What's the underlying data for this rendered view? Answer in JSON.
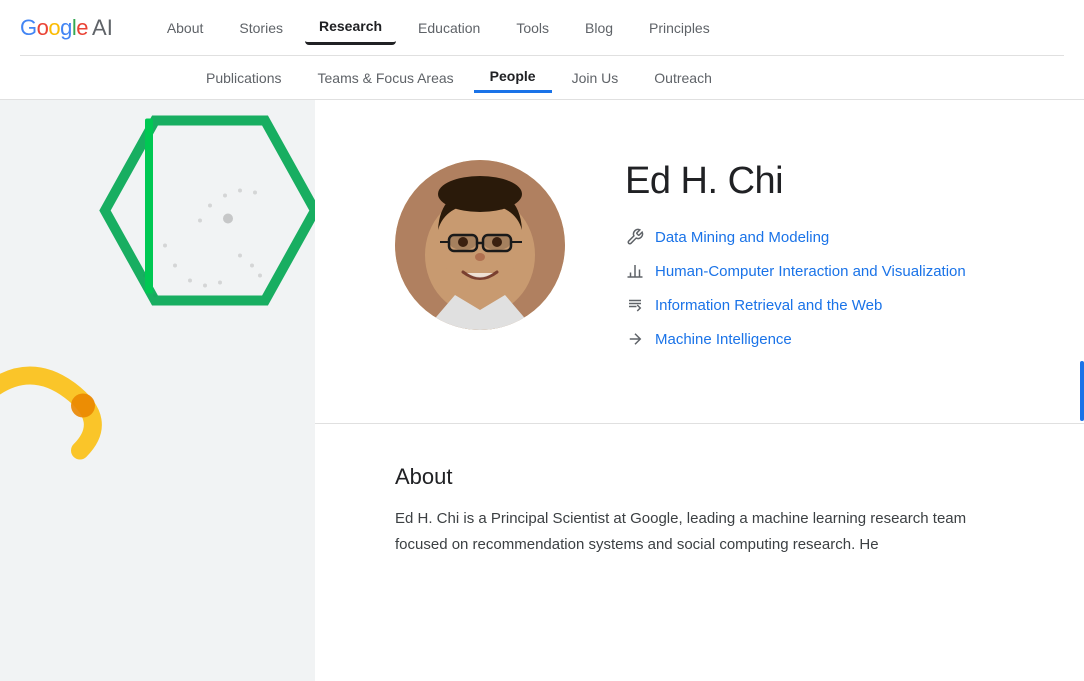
{
  "header": {
    "logo_google": "Google",
    "logo_ai": "AI",
    "nav_items": [
      {
        "label": "About",
        "active": false
      },
      {
        "label": "Stories",
        "active": false
      },
      {
        "label": "Research",
        "active": true
      },
      {
        "label": "Education",
        "active": false
      },
      {
        "label": "Tools",
        "active": false
      },
      {
        "label": "Blog",
        "active": false
      },
      {
        "label": "Principles",
        "active": false
      }
    ],
    "sub_nav_items": [
      {
        "label": "Publications",
        "active": false
      },
      {
        "label": "Teams & Focus Areas",
        "active": false
      },
      {
        "label": "People",
        "active": true
      },
      {
        "label": "Join Us",
        "active": false
      },
      {
        "label": "Outreach",
        "active": false
      }
    ]
  },
  "profile": {
    "name": "Ed H. Chi",
    "focus_areas": [
      {
        "label": "Data Mining and Modeling",
        "icon": "wrench"
      },
      {
        "label": "Human-Computer Interaction and Visualization",
        "icon": "bar-chart"
      },
      {
        "label": "Information Retrieval and the Web",
        "icon": "retrieval"
      },
      {
        "label": "Machine Intelligence",
        "icon": "arrow"
      }
    ]
  },
  "about": {
    "title": "About",
    "text": "Ed H. Chi is a Principal Scientist at Google, leading a machine learning research team focused on recommendation systems and social computing research. He"
  }
}
